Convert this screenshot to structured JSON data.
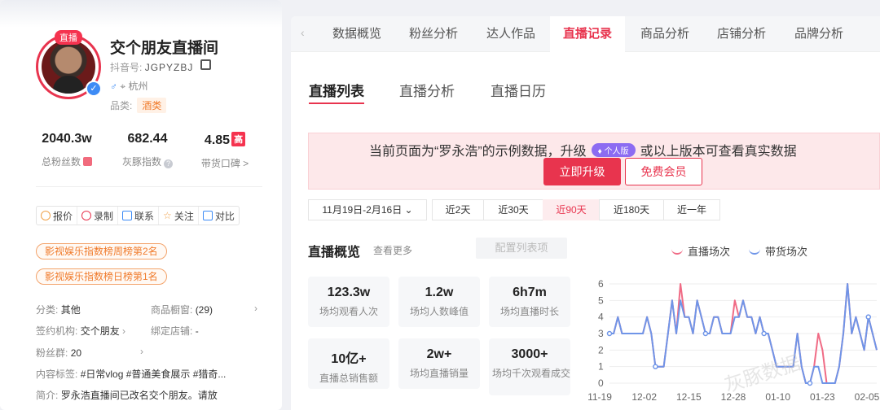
{
  "profile": {
    "live_tag": "直播",
    "name": "交个朋友直播间",
    "douyin_label": "抖音号:",
    "douyin_id": "JGPYZBJ",
    "city": "杭州",
    "category_label": "品类:",
    "category": "酒类"
  },
  "stats": [
    {
      "value": "2040.3w",
      "label": "总粉丝数"
    },
    {
      "value": "682.44",
      "label": "灰豚指数"
    },
    {
      "value": "4.85",
      "badge": "高",
      "label": "带货口碑",
      "suffix": ">"
    }
  ],
  "actions": [
    {
      "label": "报价",
      "icon": "yen-icon"
    },
    {
      "label": "录制",
      "icon": "record-icon"
    },
    {
      "label": "联系",
      "icon": "contact-icon"
    },
    {
      "label": "关注",
      "icon": "star-icon"
    },
    {
      "label": "对比",
      "icon": "compare-icon"
    }
  ],
  "ranks": [
    "影视娱乐指数榜周榜第2名",
    "影视娱乐指数榜日榜第1名"
  ],
  "info": {
    "category_k": "分类:",
    "category_v": "其他",
    "window_k": "商品橱窗:",
    "window_v": "(29)",
    "org_k": "签约机构:",
    "org_v": "交个朋友",
    "shop_k": "绑定店铺:",
    "shop_v": "-",
    "fans_k": "粉丝群:",
    "fans_v": "20",
    "tags_k": "内容标签:",
    "tags_v": "#日常vlog  #普通美食展示  #猎奇...",
    "intro_k": "简介:",
    "intro_v": "罗永浩直播间已改名交个朋友。请放"
  },
  "top_tabs": [
    "数据概览",
    "粉丝分析",
    "达人作品",
    "直播记录",
    "商品分析",
    "店铺分析",
    "品牌分析"
  ],
  "top_tabs_active": "直播记录",
  "sub_tabs": [
    "直播列表",
    "直播分析",
    "直播日历"
  ],
  "banner": {
    "text_before": "当前页面为“罗永浩”的示例数据，升级",
    "version": "个人版",
    "text_after": "或以上版本可查看真实数据",
    "upgrade": "立即升级",
    "free": "免费会员"
  },
  "ranges": [
    "11月19日-2月16日",
    "近2天",
    "近30天",
    "近90天",
    "近180天",
    "近一年"
  ],
  "range_active": "近90天",
  "overview": {
    "title": "直播概览",
    "more": "查看更多",
    "config": "配置列表项",
    "cards": [
      {
        "value": "123.3w",
        "label": "场均观看人次"
      },
      {
        "value": "1.2w",
        "label": "场均人数峰值"
      },
      {
        "value": "6h7m",
        "label": "场均直播时长"
      },
      {
        "value": "10亿+",
        "label": "直播总销售额"
      },
      {
        "value": "2w+",
        "label": "场均直播销量"
      },
      {
        "value": "3000+",
        "label": "场均千次观看成交"
      }
    ]
  },
  "watermark": "灰豚数据",
  "chart_data": {
    "type": "line",
    "x_ticks": [
      "11-19",
      "12-02",
      "12-15",
      "12-28",
      "01-10",
      "01-23",
      "02-05"
    ],
    "y_ticks": [
      0,
      1,
      2,
      3,
      4,
      5,
      6
    ],
    "ylim": [
      0,
      6
    ],
    "series": [
      {
        "name": "直播场次",
        "color": "#f06b85",
        "values": [
          3,
          3,
          4,
          3,
          3,
          3,
          3,
          3,
          3,
          4,
          3,
          1,
          1,
          1,
          3,
          5,
          3,
          6,
          4,
          4,
          3,
          5,
          4,
          3,
          3,
          4,
          4,
          3,
          3,
          3,
          5,
          4,
          5,
          4,
          4,
          3,
          4,
          3,
          3,
          2,
          1,
          1,
          1,
          1,
          1,
          3,
          1,
          0,
          0,
          1,
          3,
          2,
          0,
          0,
          0,
          1,
          3,
          6,
          3,
          4,
          3,
          2,
          4,
          3,
          2
        ]
      },
      {
        "name": "带货场次",
        "color": "#6f95e8",
        "values": [
          3,
          3,
          4,
          3,
          3,
          3,
          3,
          3,
          3,
          4,
          3,
          1,
          1,
          1,
          3,
          5,
          3,
          5,
          4,
          4,
          3,
          5,
          4,
          3,
          3,
          4,
          4,
          3,
          3,
          3,
          4,
          4,
          5,
          4,
          4,
          3,
          4,
          3,
          3,
          2,
          1,
          1,
          1,
          1,
          1,
          3,
          1,
          0,
          0,
          1,
          1,
          0,
          0,
          0,
          0,
          1,
          3,
          6,
          3,
          4,
          3,
          2,
          4,
          3,
          2
        ]
      }
    ]
  },
  "colors": {
    "accent": "#e8344e",
    "version_purple": "#8c6cf2",
    "series_pink": "#f06b85",
    "series_blue": "#6f95e8"
  }
}
